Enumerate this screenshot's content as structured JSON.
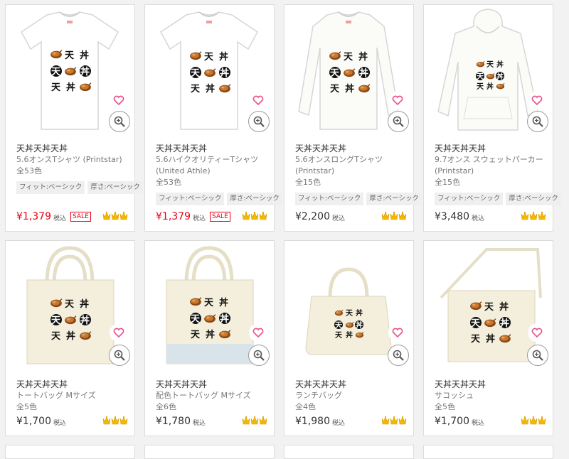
{
  "products": [
    {
      "title": "天丼天丼天丼",
      "type": "5.6オンスTシャツ (Printstar)",
      "colors": "全53色",
      "tags": [
        "フィット:ベーシック",
        "厚さ:ベーシック"
      ],
      "price": "¥1,379",
      "tax": "税込",
      "sale": "SALE"
    },
    {
      "title": "天丼天丼天丼",
      "type": "5.6ハイクオリティーTシャツ (United Athle)",
      "colors": "全53色",
      "tags": [
        "フィット:ベーシック",
        "厚さ:ベーシック"
      ],
      "price": "¥1,379",
      "tax": "税込",
      "sale": "SALE"
    },
    {
      "title": "天丼天丼天丼",
      "type": "5.6オンスロングTシャツ (Printstar)",
      "colors": "全15色",
      "tags": [
        "フィット:ベーシック",
        "厚さ:ベーシック"
      ],
      "price": "¥2,200",
      "tax": "税込",
      "sale": ""
    },
    {
      "title": "天丼天丼天丼",
      "type": "9.7オンス スウェットパーカー (Printstar)",
      "colors": "全15色",
      "tags": [
        "フィット:ベーシック",
        "厚さ:ベーシック"
      ],
      "price": "¥3,480",
      "tax": "税込",
      "sale": ""
    },
    {
      "title": "天丼天丼天丼",
      "type": "トートバッグ Mサイズ",
      "colors": "全5色",
      "tags": [],
      "price": "¥1,700",
      "tax": "税込",
      "sale": ""
    },
    {
      "title": "天丼天丼天丼",
      "type": "配色トートバッグ Mサイズ",
      "colors": "全6色",
      "tags": [],
      "price": "¥1,780",
      "tax": "税込",
      "sale": ""
    },
    {
      "title": "天丼天丼天丼",
      "type": "ランチバッグ",
      "colors": "全4色",
      "tags": [],
      "price": "¥1,980",
      "tax": "税込",
      "sale": ""
    },
    {
      "title": "天丼天丼天丼",
      "type": "サコッシュ",
      "colors": "全5色",
      "tags": [],
      "price": "¥1,700",
      "tax": "税込",
      "sale": ""
    }
  ],
  "design": {
    "glyph_ten": "天",
    "glyph_don": "丼"
  },
  "colors": {
    "sale_red": "#e60012",
    "heart_pink": "#e8508a",
    "crown_gold": "#f5b800",
    "tempura": "#b5651d"
  }
}
